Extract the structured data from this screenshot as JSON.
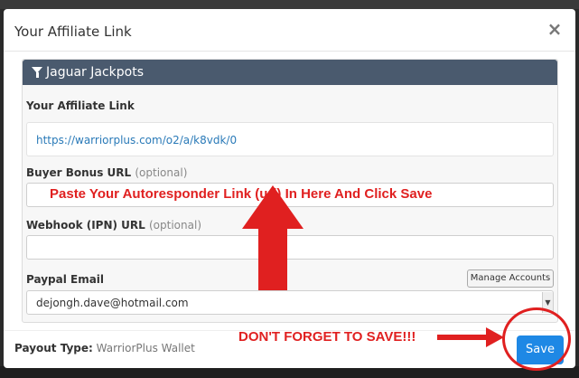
{
  "modal": {
    "title": "Your Affiliate Link",
    "close_symbol": "×"
  },
  "panel": {
    "title": "Jaguar Jackpots",
    "affiliate_link_label": "Your Affiliate Link",
    "affiliate_link_value": "https://warriorplus.com/o2/a/k8vdk/0",
    "buyer_bonus_label": "Buyer Bonus URL",
    "buyer_bonus_optional": "(optional)",
    "buyer_bonus_value": "",
    "webhook_label": "Webhook (IPN) URL",
    "webhook_optional": "(optional)",
    "webhook_value": "",
    "paypal_label": "Paypal Email",
    "manage_accounts_label": "Manage Accounts",
    "paypal_selected": "dejongh.dave@hotmail.com"
  },
  "footer": {
    "payout_key": "Payout Type:",
    "payout_value": "WarriorPlus Wallet",
    "save_label": "Save"
  },
  "annotations": {
    "paste_instruction": "Paste Your Autoresponder Link (url) In Here And Click Save",
    "save_reminder": "DON'T FORGET TO SAVE!!!",
    "color": "#e02020"
  },
  "icons": {
    "panel_header": "filter-icon",
    "close": "close-icon",
    "select": "chevron-down-icon"
  }
}
